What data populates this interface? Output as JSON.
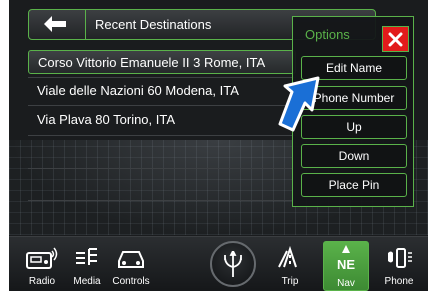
{
  "header": {
    "title": "Recent Destinations"
  },
  "destinations": [
    {
      "label": "Corso Vittorio Emanuele II 3 Rome, ITA"
    },
    {
      "label": "Viale delle Nazioni 60 Modena, ITA"
    },
    {
      "label": "Via Plava 80 Torino, ITA"
    }
  ],
  "options": {
    "title": "Options",
    "buttons": [
      "Edit Name",
      "Phone Number",
      "Up",
      "Down",
      "Place Pin"
    ]
  },
  "navbar": {
    "items": [
      {
        "label": "Radio",
        "icon": "radio-icon"
      },
      {
        "label": "Media",
        "icon": "media-icon"
      },
      {
        "label": "Controls",
        "icon": "controls-icon"
      },
      {
        "label": "Trip",
        "icon": "trip-icon"
      },
      {
        "label": "Nav",
        "icon": "compass-icon",
        "compass": "NE"
      },
      {
        "label": "Phone",
        "icon": "phone-icon"
      }
    ]
  },
  "colors": {
    "accent": "#5ab24a",
    "close": "#e21b1b",
    "pointer": "#1a6fd6"
  }
}
